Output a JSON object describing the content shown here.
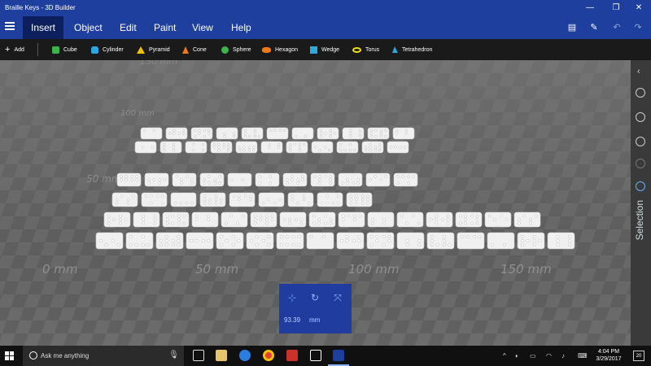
{
  "window": {
    "title": "Braille Keys - 3D Builder",
    "controls": {
      "minimize": "—",
      "maximize": "❐",
      "close": "✕"
    }
  },
  "menu": {
    "tabs": [
      "Insert",
      "Object",
      "Edit",
      "Paint",
      "View",
      "Help"
    ],
    "active_tab": "Insert",
    "right_icons": [
      "print-icon",
      "pin-icon",
      "undo-icon",
      "redo-icon"
    ]
  },
  "toolbar": {
    "add_label": "Add",
    "items": [
      {
        "label": "Cube",
        "icon": "cube-icon",
        "color": "#3bb54a"
      },
      {
        "label": "Cylinder",
        "icon": "cylinder-icon",
        "color": "#2ea7e0"
      },
      {
        "label": "Pyramid",
        "icon": "pyramid-icon",
        "color": "#f2c200"
      },
      {
        "label": "Cone",
        "icon": "cone-icon",
        "color": "#f07a1a"
      },
      {
        "label": "Sphere",
        "icon": "sphere-icon",
        "color": "#3bb54a"
      },
      {
        "label": "Hexagon",
        "icon": "hexagon-icon",
        "color": "#f07a1a"
      },
      {
        "label": "Wedge",
        "icon": "wedge-icon",
        "color": "#2ea7e0"
      },
      {
        "label": "Torus",
        "icon": "torus-icon",
        "color": "#f2e000"
      },
      {
        "label": "Tetrahedron",
        "icon": "tetrahedron-icon",
        "color": "#2ea7e0"
      }
    ]
  },
  "viewport": {
    "ruler_labels": [
      "0 mm",
      "50 mm",
      "100 mm",
      "150 mm"
    ],
    "depth_labels": [
      "50 mm",
      "100 mm",
      "150 mm"
    ],
    "floor_color_light": "#6a6a6a",
    "floor_color_dark": "#5e5e5e",
    "key_color": "#f0f0f0"
  },
  "side_panel": {
    "label": "Selection",
    "icons": [
      "collapse-chevron-icon",
      "object-icon-1",
      "object-icon-2",
      "compass-icon",
      "circle-icon",
      "selection-icon"
    ]
  },
  "scale_panel": {
    "value": "93.39",
    "unit": "mm",
    "icons": [
      "move-icon",
      "rotate-icon",
      "scale-icon"
    ]
  },
  "taskbar": {
    "search_placeholder": "Ask me anything",
    "time": "4:04 PM",
    "date": "3/29/2017",
    "notification_count": "20"
  }
}
